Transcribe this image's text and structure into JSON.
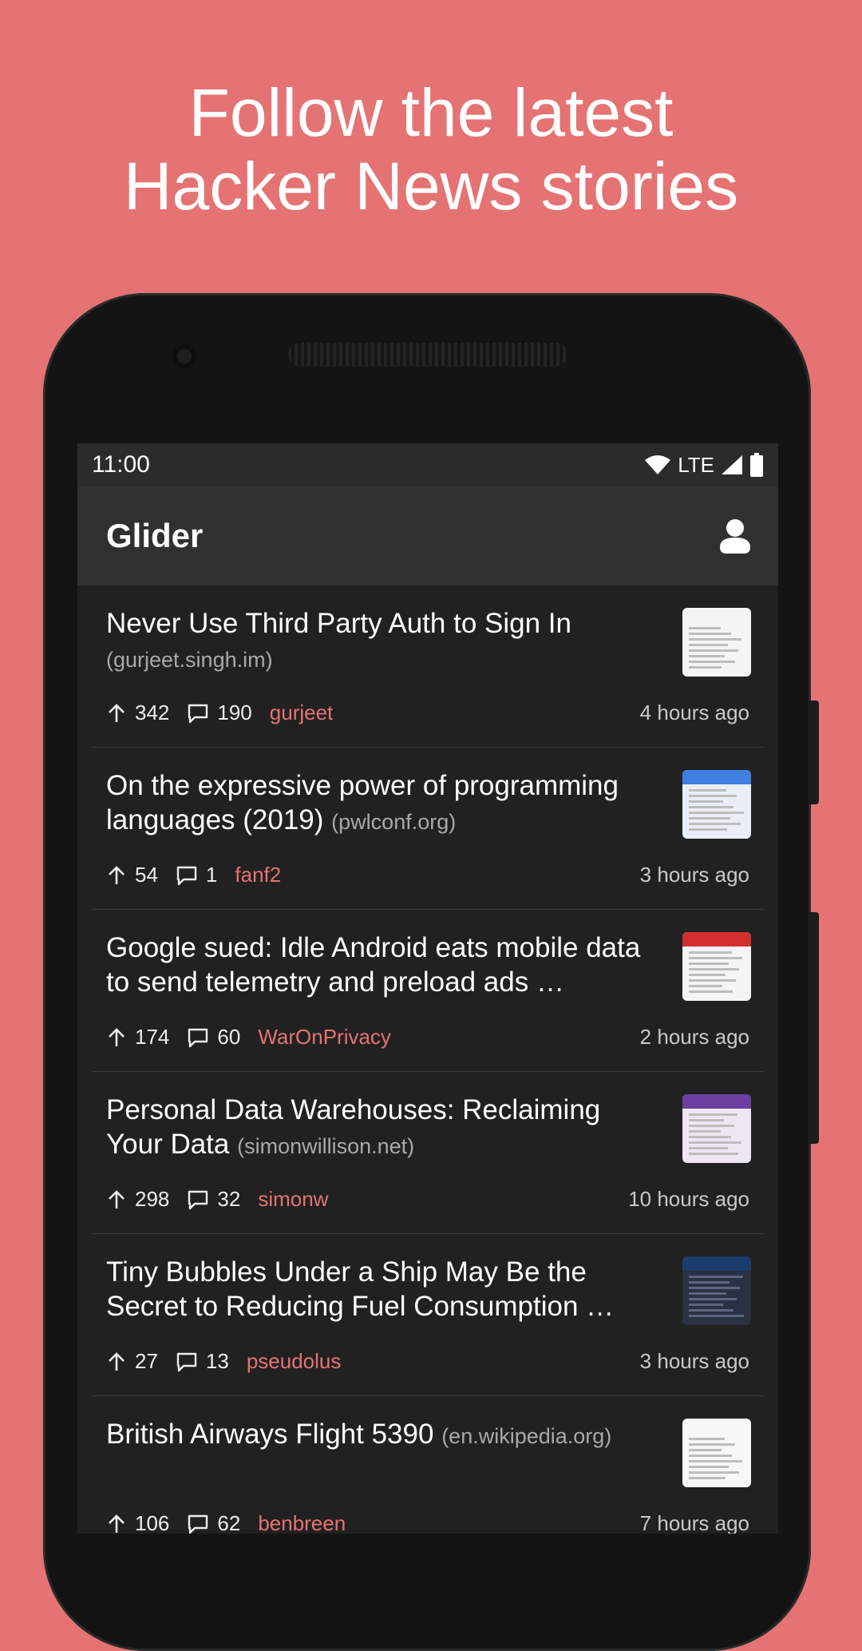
{
  "headline": {
    "line1": "Follow the latest",
    "line2": "Hacker News stories"
  },
  "status_bar": {
    "time": "11:00",
    "network": "LTE"
  },
  "app_bar": {
    "title": "Glider",
    "account_icon": "account-icon"
  },
  "stories": [
    {
      "title": "Never Use Third Party Auth to Sign In",
      "domain": "(gurjeet.singh.im)",
      "points": "342",
      "comments": "190",
      "user": "gurjeet",
      "time": "4 hours ago"
    },
    {
      "title": "On the expressive power of programming languages (2019)",
      "domain": "(pwlconf.org)",
      "points": "54",
      "comments": "1",
      "user": "fanf2",
      "time": "3 hours ago"
    },
    {
      "title": "Google sued: Idle Android eats mobile data to send telemetry and preload ads …",
      "domain": "",
      "points": "174",
      "comments": "60",
      "user": "WarOnPrivacy",
      "time": "2 hours ago"
    },
    {
      "title": "Personal Data Warehouses: Reclaiming Your Data",
      "domain": "(simonwillison.net)",
      "points": "298",
      "comments": "32",
      "user": "simonw",
      "time": "10 hours ago"
    },
    {
      "title": "Tiny Bubbles Under a Ship May Be the Secret to Reducing Fuel Consumption …",
      "domain": "",
      "points": "27",
      "comments": "13",
      "user": "pseudolus",
      "time": "3 hours ago"
    },
    {
      "title": "British Airways Flight 5390",
      "domain": "(en.wikipedia.org)",
      "points": "106",
      "comments": "62",
      "user": "benbreen",
      "time": "7 hours ago"
    }
  ],
  "colors": {
    "accent": "#e57373",
    "background": "#212121",
    "appbar": "#303030"
  }
}
